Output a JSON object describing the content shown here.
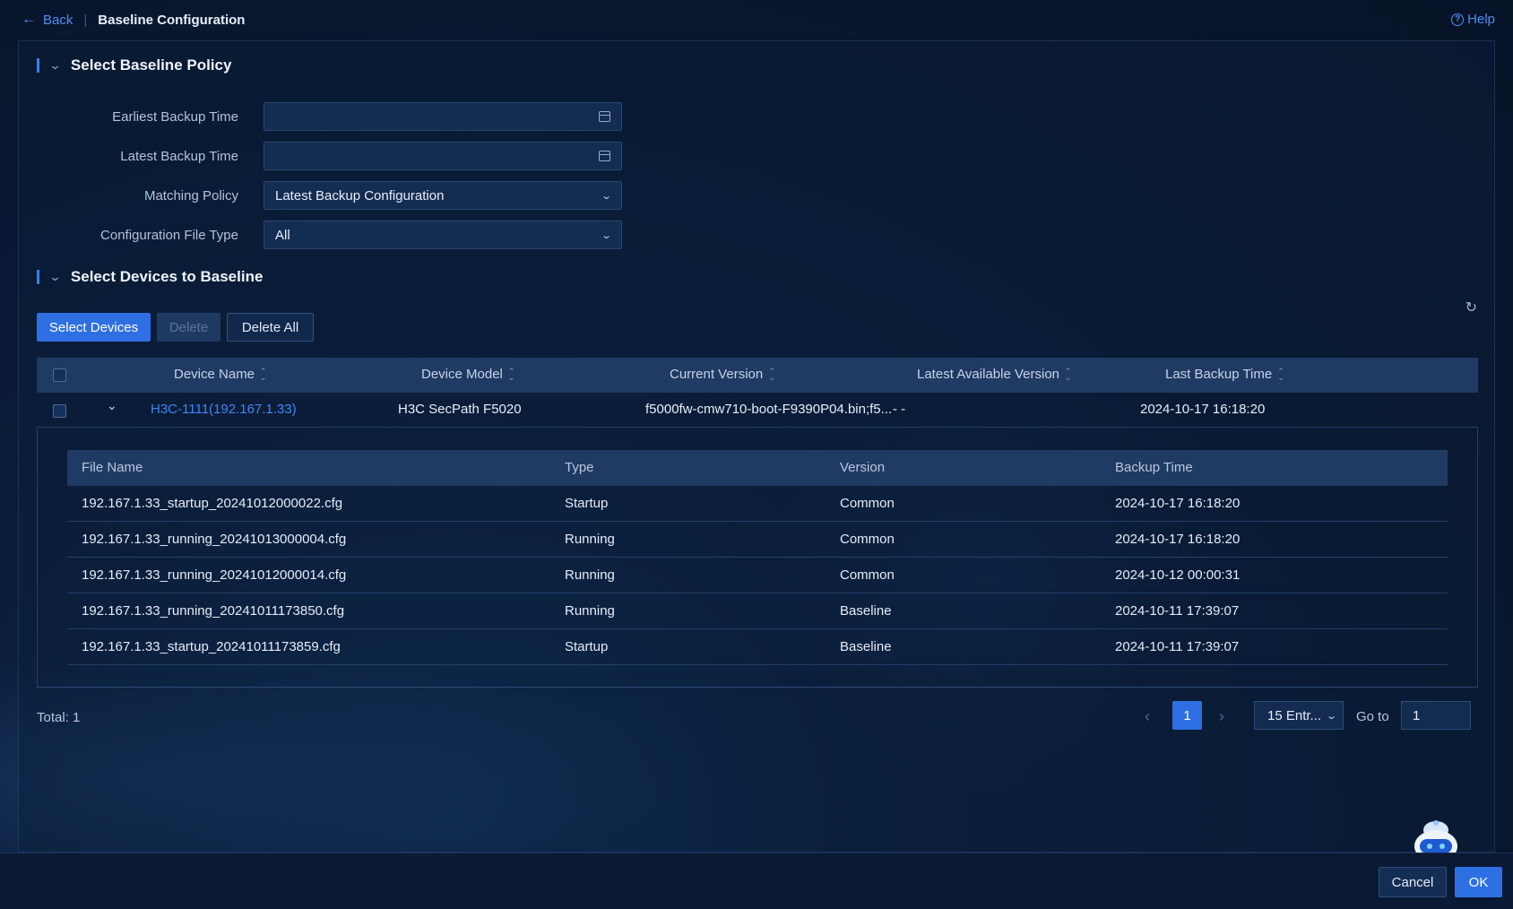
{
  "colors": {
    "accent": "#2f6fe4",
    "link": "#3f86f5",
    "background": "#0b1d3a",
    "header_row": "#1f3a63"
  },
  "topbar": {
    "back_label": "Back",
    "separator": "|",
    "title": "Baseline Configuration",
    "help_label": "Help"
  },
  "policy_section": {
    "title": "Select Baseline Policy",
    "fields": [
      {
        "label": "Earliest Backup Time",
        "value": "",
        "icon": "calendar-icon"
      },
      {
        "label": "Latest Backup Time",
        "value": "",
        "icon": "calendar-icon"
      },
      {
        "label": "Matching Policy",
        "value": "Latest Backup Configuration",
        "icon": "chevron-down-icon"
      },
      {
        "label": "Configuration File Type",
        "value": "All",
        "icon": "chevron-down-icon"
      }
    ]
  },
  "devices_section": {
    "title": "Select Devices to Baseline",
    "buttons": {
      "select_devices": "Select Devices",
      "delete": "Delete",
      "delete_all": "Delete All"
    },
    "columns": [
      "Device Name",
      "Device Model",
      "Current Version",
      "Latest Available Version",
      "Last Backup Time"
    ],
    "rows": [
      {
        "device_name": "H3C-1111(192.167.1.33)",
        "device_model": "H3C SecPath F5020",
        "current_version": "f5000fw-cmw710-boot-F9390P04.bin;f5...",
        "latest_available_version": "- -",
        "last_backup_time": "2024-10-17 16:18:20"
      }
    ],
    "files": {
      "columns": [
        "File Name",
        "Type",
        "Version",
        "Backup Time"
      ],
      "rows": [
        [
          "192.167.1.33_startup_20241012000022.cfg",
          "Startup",
          "Common",
          "2024-10-17 16:18:20"
        ],
        [
          "192.167.1.33_running_20241013000004.cfg",
          "Running",
          "Common",
          "2024-10-17 16:18:20"
        ],
        [
          "192.167.1.33_running_20241012000014.cfg",
          "Running",
          "Common",
          "2024-10-12 00:00:31"
        ],
        [
          "192.167.1.33_running_20241011173850.cfg",
          "Running",
          "Baseline",
          "2024-10-11 17:39:07"
        ],
        [
          "192.167.1.33_startup_20241011173859.cfg",
          "Startup",
          "Baseline",
          "2024-10-11 17:39:07"
        ]
      ]
    }
  },
  "pagination": {
    "total": "Total: 1",
    "current_page": "1",
    "page_size": "15 Entr...",
    "goto_label": "Go to",
    "goto_value": "1"
  },
  "footer": {
    "cancel": "Cancel",
    "ok": "OK"
  }
}
